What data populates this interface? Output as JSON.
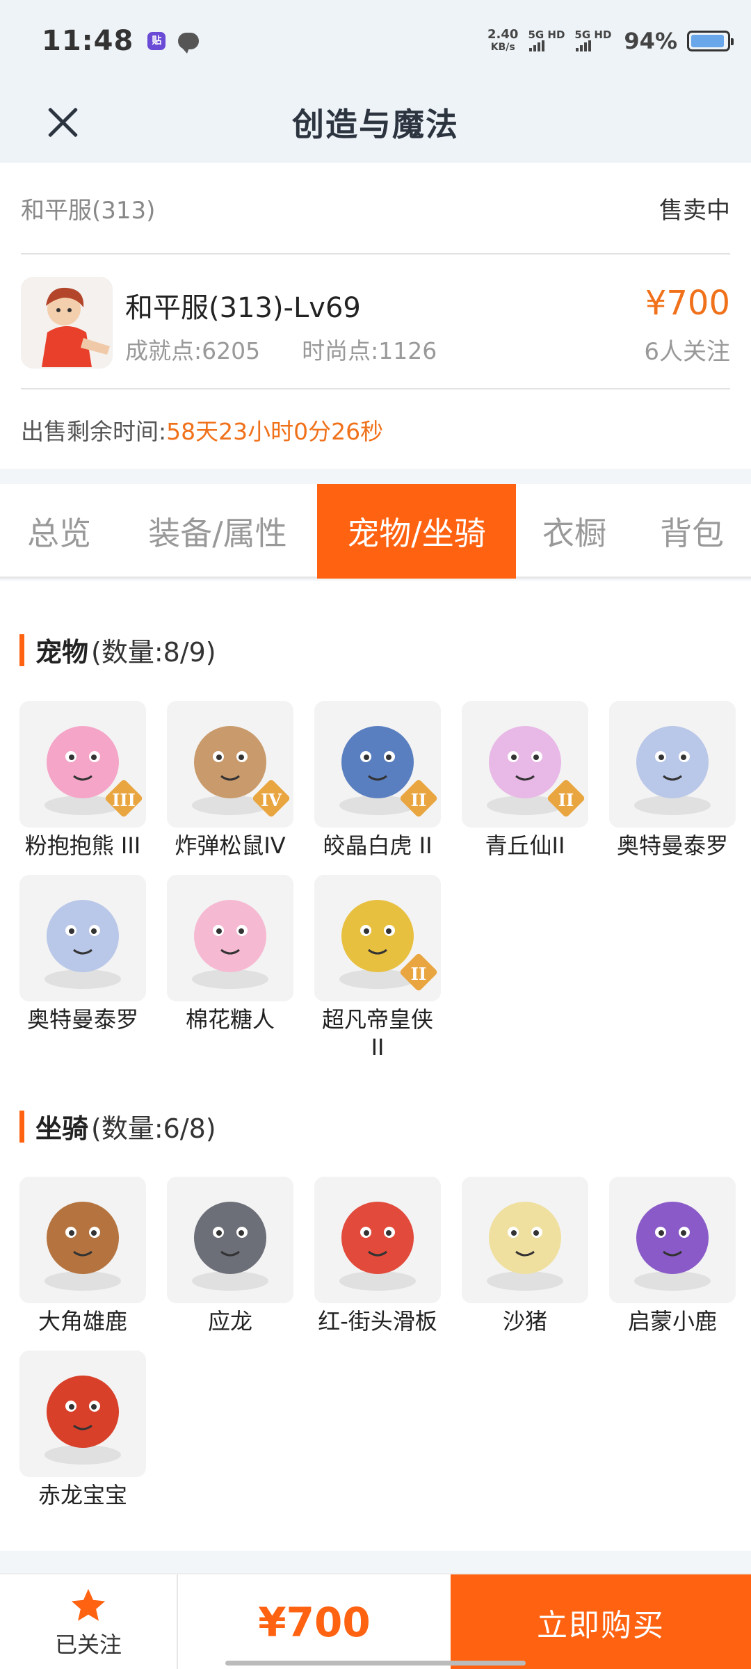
{
  "status_bar": {
    "time": "11:48",
    "app_icon_text": "贴",
    "net_speed_value": "2.40",
    "net_speed_unit": "KB/s",
    "signal1": "5G HD",
    "signal2": "5G HD",
    "battery_percent": "94%"
  },
  "header": {
    "title": "创造与魔法"
  },
  "listing": {
    "server": "和平服(313)",
    "status": "售卖中",
    "title": "和平服(313)-Lv69",
    "achievement": "成就点:6205",
    "fashion": "时尚点:1126",
    "price": "¥700",
    "followers": "6人关注",
    "remaining_label": "出售剩余时间:",
    "remaining_value": "58天23小时0分26秒"
  },
  "tabs": [
    {
      "label": "总览",
      "active": false
    },
    {
      "label": "装备/属性",
      "active": false
    },
    {
      "label": "宠物/坐骑",
      "active": true
    },
    {
      "label": "衣橱",
      "active": false
    },
    {
      "label": "背包",
      "active": false
    }
  ],
  "pets": {
    "title": "宠物",
    "count": "(数量:8/9)",
    "items": [
      {
        "name": "粉抱抱熊 III",
        "tier": "III",
        "icon": "pink-bear-icon",
        "color": "#f5a6c8"
      },
      {
        "name": "炸弹松鼠IV",
        "tier": "IV",
        "icon": "bomb-squirrel-icon",
        "color": "#c99a6b"
      },
      {
        "name": "皎晶白虎 II",
        "tier": "II",
        "icon": "white-tiger-icon",
        "color": "#5a7fc0"
      },
      {
        "name": "青丘仙II",
        "tier": "II",
        "icon": "fox-fairy-icon",
        "color": "#e8b8e6"
      },
      {
        "name": "奥特曼泰罗",
        "tier": "",
        "icon": "ultraman-taro-icon",
        "color": "#b9c7e8"
      },
      {
        "name": "奥特曼泰罗",
        "tier": "",
        "icon": "ultraman-taro-icon",
        "color": "#b9c7e8"
      },
      {
        "name": "棉花糖人",
        "tier": "",
        "icon": "marshmallow-man-icon",
        "color": "#f6b9d2"
      },
      {
        "name": "超凡帝皇侠 II",
        "tier": "II",
        "icon": "emperor-knight-icon",
        "color": "#e8c040"
      }
    ]
  },
  "mounts": {
    "title": "坐骑",
    "count": "(数量:6/8)",
    "items": [
      {
        "name": "大角雄鹿",
        "icon": "stag-icon",
        "color": "#b5743f"
      },
      {
        "name": "应龙",
        "icon": "dragon-icon",
        "color": "#6c6f78"
      },
      {
        "name": "红-街头滑板",
        "icon": "skateboard-icon",
        "color": "#e24a3b"
      },
      {
        "name": "沙猪",
        "icon": "sand-pig-icon",
        "color": "#f0e0a0"
      },
      {
        "name": "启蒙小鹿",
        "icon": "fawn-icon",
        "color": "#8a5bc8"
      },
      {
        "name": "赤龙宝宝",
        "icon": "baby-red-dragon-icon",
        "color": "#d8402a"
      }
    ]
  },
  "bottom_bar": {
    "follow_label": "已关注",
    "price": "¥700",
    "buy_label": "立即购买"
  },
  "colors": {
    "accent": "#ff6211",
    "price": "#f0711a"
  }
}
